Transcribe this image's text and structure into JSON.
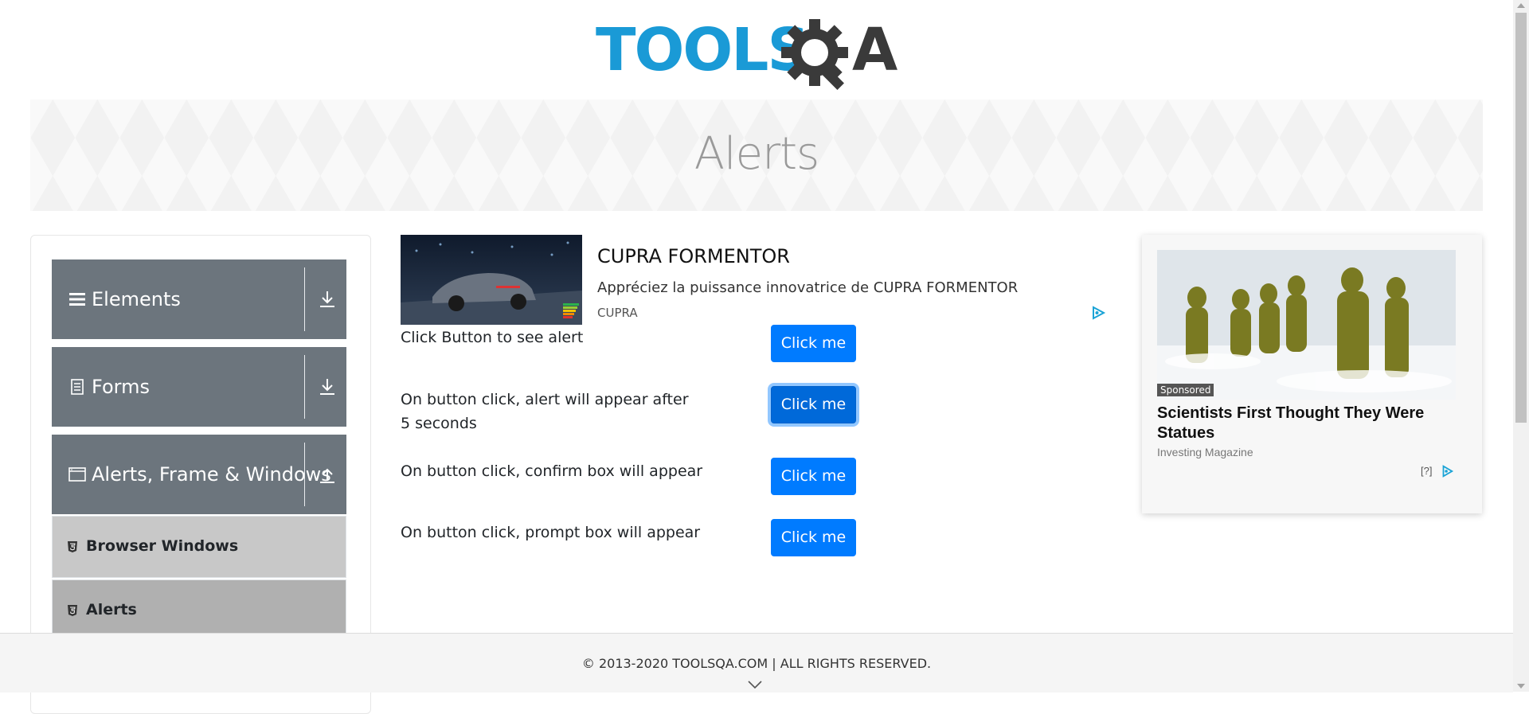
{
  "header": {
    "logo_text_tools": "TOOLS",
    "logo_text_qa": "QA",
    "brand_color": "#1a9ad6",
    "logo_dark": "#3a3a3a"
  },
  "banner": {
    "title": "Alerts"
  },
  "sidebar": {
    "groups": [
      {
        "label": "Elements",
        "icon": "hamburger-icon",
        "arrow": "download-arrow-icon"
      },
      {
        "label": "Forms",
        "icon": "document-icon",
        "arrow": "download-arrow-icon"
      },
      {
        "label": "Alerts, Frame & Windows",
        "icon": "window-icon",
        "arrow": "upload-arrow-icon"
      }
    ],
    "items": [
      {
        "label": "Browser Windows",
        "icon": "html5-icon"
      },
      {
        "label": "Alerts",
        "icon": "html5-icon"
      }
    ]
  },
  "ad_top": {
    "title": "CUPRA FORMENTOR",
    "description": "Appréciez la puissance innovatrice de CUPRA FORMENTOR",
    "brand": "CUPRA"
  },
  "rows": [
    {
      "label": "Click Button to see alert",
      "button": "Click me"
    },
    {
      "label": "On button click, alert will appear after 5 seconds",
      "button": "Click me"
    },
    {
      "label": "On button click, confirm box will appear",
      "button": "Click me"
    },
    {
      "label": "On button click, prompt box will appear",
      "button": "Click me"
    }
  ],
  "ad_right": {
    "sponsored": "Sponsored",
    "title": "Scientists First Thought They Were Statues",
    "brand": "Investing Magazine",
    "info": "[?]"
  },
  "footer": {
    "text": "© 2013-2020 TOOLSQA.COM | ALL RIGHTS RESERVED."
  },
  "colors": {
    "primary_button": "#007bff",
    "sidebar_header": "#6c757d",
    "active_item": "#b8b8b8",
    "item_bg": "#c8c8c8"
  }
}
